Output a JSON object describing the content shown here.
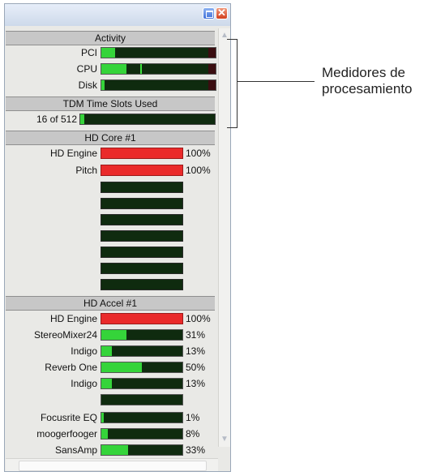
{
  "titlebar": {
    "minimize_icon": "minimize-icon",
    "close_icon": "close-icon",
    "close_glyph": "✕"
  },
  "activity": {
    "header": "Activity",
    "meters": [
      {
        "label": "PCI",
        "level": 0.12
      },
      {
        "label": "CPU",
        "level": 0.22
      },
      {
        "label": "Disk",
        "level": 0.02
      }
    ]
  },
  "tdm": {
    "header": "TDM Time Slots Used",
    "value": "16 of 512",
    "level": 0.03
  },
  "hd_core": {
    "header": "HD Core #1",
    "rows": [
      {
        "label": "HD Engine",
        "percent": "100%"
      },
      {
        "label": "Pitch",
        "percent": "100%"
      }
    ],
    "empty_slots": 7
  },
  "hd_accel": {
    "header": "HD Accel #1",
    "rows": [
      {
        "label": "HD Engine",
        "percent": "100%",
        "level": 1.0
      },
      {
        "label": "StereoMixer24",
        "percent": "31%",
        "level": 0.31
      },
      {
        "label": "Indigo",
        "percent": "13%",
        "level": 0.13
      },
      {
        "label": "Reverb One",
        "percent": "50%",
        "level": 0.5
      },
      {
        "label": "Indigo",
        "percent": "13%",
        "level": 0.13
      },
      {
        "label": "",
        "percent": "",
        "level": 0.0
      },
      {
        "label": "Focusrite EQ",
        "percent": "1%",
        "level": 0.01
      },
      {
        "label": "moogerfooger",
        "percent": "8%",
        "level": 0.08
      },
      {
        "label": "SansAmp",
        "percent": "33%",
        "level": 0.33
      }
    ]
  },
  "annotation": {
    "line1": "Medidores de",
    "line2": "procesamiento"
  },
  "colors": {
    "meter_green": "#35d43a",
    "meter_red": "#ea2a2a",
    "meter_bg": "#0f2b0f",
    "header_bg": "#c7c7c7"
  }
}
